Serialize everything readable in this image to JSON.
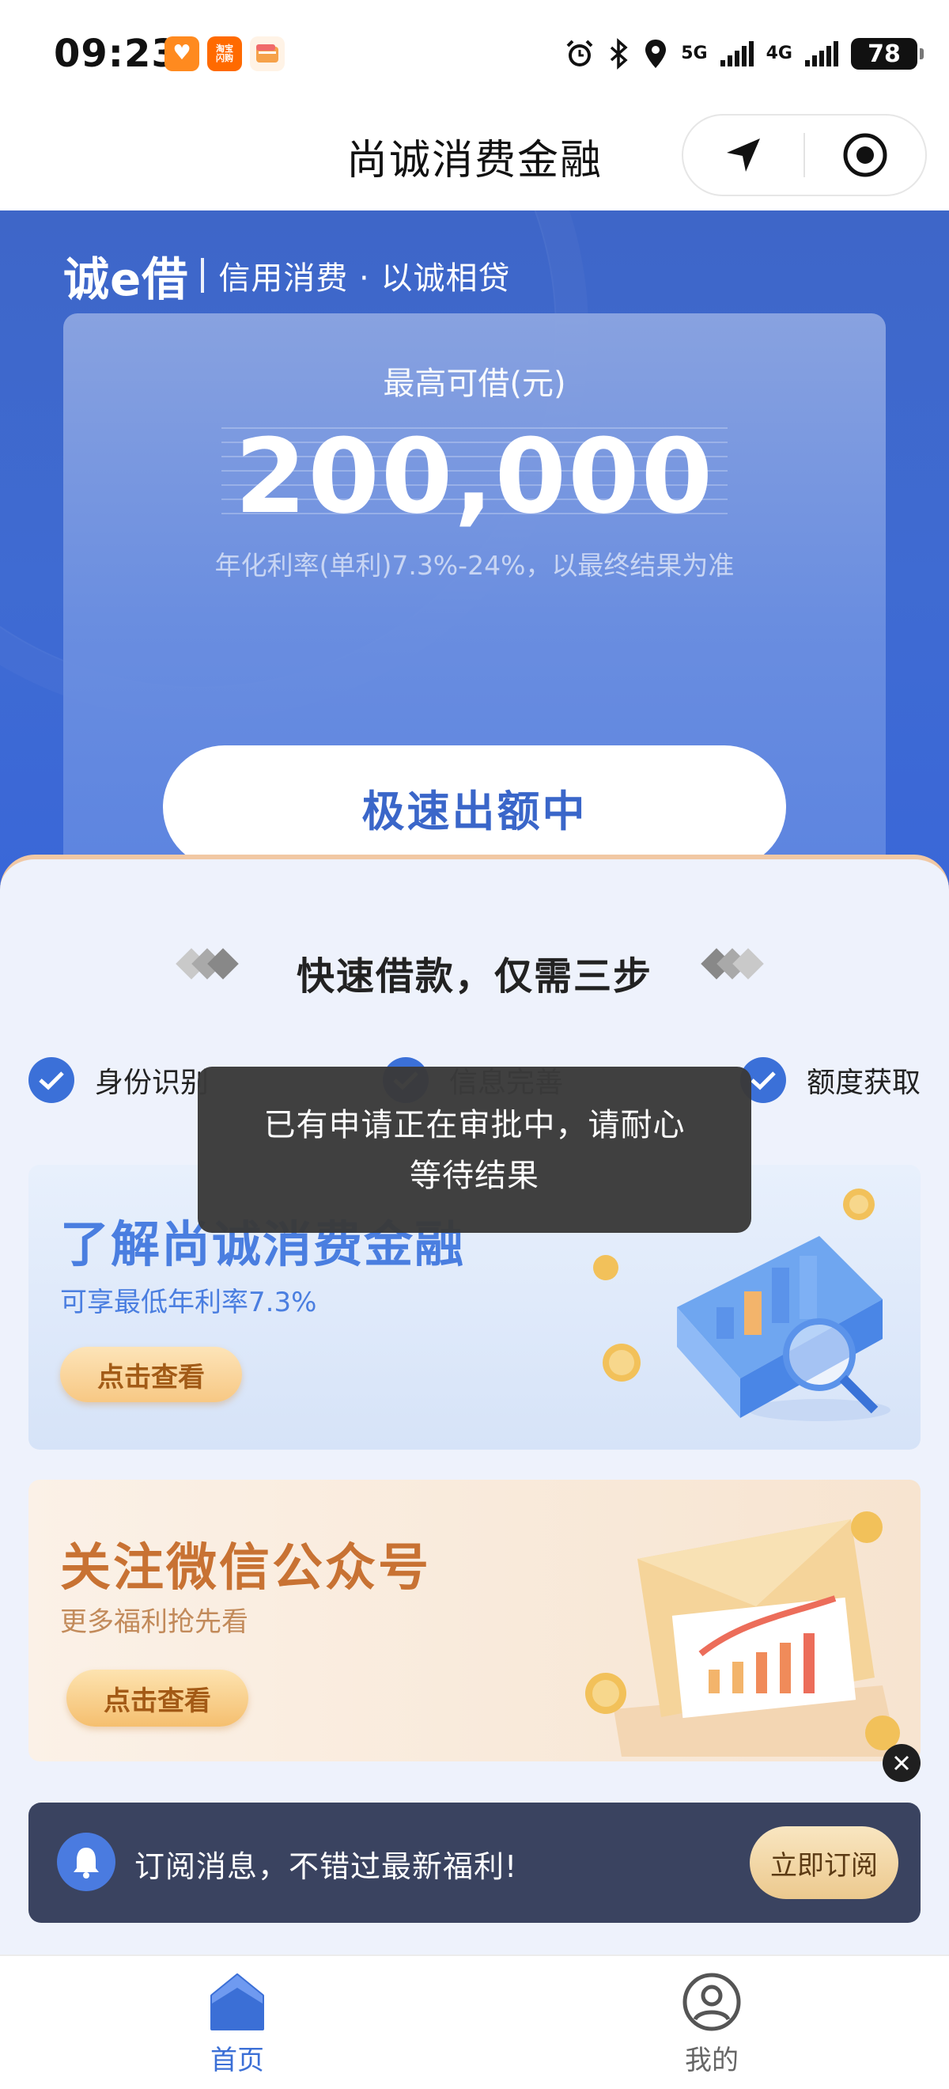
{
  "status_bar": {
    "time": "09:23",
    "app_icons": [
      {
        "name": "health-app-icon",
        "label": ""
      },
      {
        "name": "taobao-app-icon",
        "label": "淘宝\n闪购"
      },
      {
        "name": "wallet-app-icon",
        "label": ""
      }
    ],
    "network_5g": "5G",
    "network_4g": "4G",
    "battery": "78",
    "icons": [
      "alarm-icon",
      "bluetooth-icon",
      "location-icon",
      "signal-icon",
      "battery-icon"
    ]
  },
  "nav": {
    "title": "尚诚消费金融",
    "capsule_icons": [
      "navigate-arrow-icon",
      "target-record-icon"
    ]
  },
  "hero": {
    "brand_name": "诚e借",
    "brand_slogan": "信用消费 · 以诚相贷",
    "limit_label": "最高可借(元)",
    "limit_amount": "200,000",
    "rate_note": "年化利率(单利)7.3%-24%，以最终结果为准",
    "cta_label": "极速出额中"
  },
  "steps": {
    "title": "快速借款，仅需三步",
    "items": [
      {
        "label": "身份识别"
      },
      {
        "label": "信息完善"
      },
      {
        "label": "额度获取"
      }
    ]
  },
  "banners": {
    "learn": {
      "title": "了解尚诚消费金融",
      "subtitle": "可享最低年利率7.3%",
      "button": "点击查看"
    },
    "wechat": {
      "title": "关注微信公众号",
      "subtitle": "更多福利抢先看",
      "button": "点击查看"
    }
  },
  "subscribe": {
    "text": "订阅消息，不错过最新福利!",
    "button": "立即订阅"
  },
  "toast": {
    "text": "已有申请正在审批中，请耐心等待结果"
  },
  "tabbar": {
    "tabs": [
      {
        "label": "首页",
        "active": true
      },
      {
        "label": "我的",
        "active": false
      }
    ]
  },
  "colors": {
    "primary": "#3b6fd6",
    "hero_bg": "#3e66c8",
    "orange_accent": "#c87233",
    "subscribe_bg": "#3a4360"
  }
}
